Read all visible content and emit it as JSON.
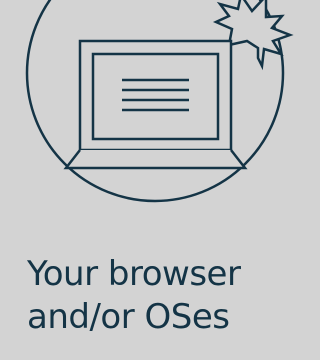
{
  "caption": {
    "line1": "Your browser",
    "line2": "and/or OSes"
  },
  "colors": {
    "background": "#d3d3d3",
    "ink": "#143446"
  },
  "icons": {
    "illustration": "laptop-with-burst-icon"
  }
}
